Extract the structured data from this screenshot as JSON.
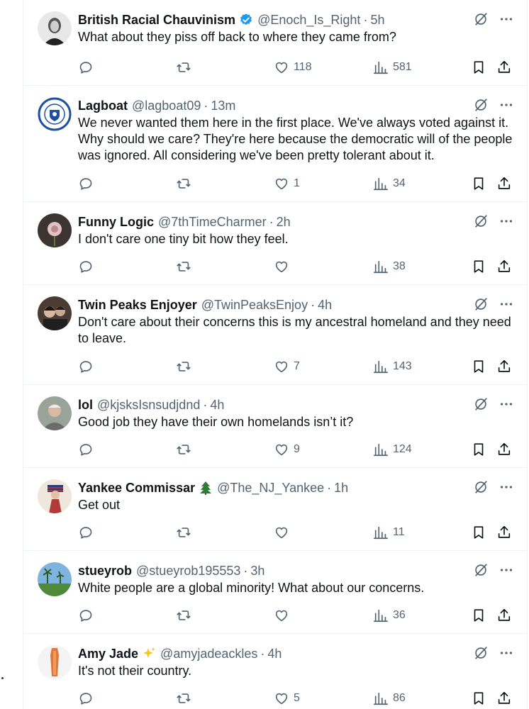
{
  "colors": {
    "text": "#0f1419",
    "secondary": "#536471",
    "verified": "#1d9bf0",
    "border": "#eff3f4"
  },
  "tweets": [
    {
      "name": "British Racial Chauvinism",
      "verified": true,
      "handle": "@Enoch_Is_Right",
      "time": "5h",
      "text": "What about they piss off back to where they came from?",
      "likes": "118",
      "views": "581"
    },
    {
      "name": "Lagboat",
      "handle": "@lagboat09",
      "time": "13m",
      "text": "We never wanted them here in the first place. We've always voted against it. Why should we care? They're here because the democratic will of the people was ignored. All considering we've been pretty tolerant about it.",
      "likes": "1",
      "views": "34"
    },
    {
      "name": "Funny Logic",
      "handle": "@7thTimeCharmer",
      "time": "2h",
      "text": "I don't care one tiny bit how they feel.",
      "likes": "",
      "views": "38"
    },
    {
      "name": "Twin Peaks Enjoyer",
      "handle": "@TwinPeaksEnjoy",
      "time": "4h",
      "text": "Don't care about their concerns this is my ancestral homeland and they need to leave.",
      "likes": "7",
      "views": "143"
    },
    {
      "name": "lol",
      "handle": "@kjsksIsnsudjdnd",
      "time": "4h",
      "text": "Good job they have their own homelands isn’t it?",
      "likes": "9",
      "views": "124"
    },
    {
      "name": "Yankee Commissar",
      "name_emoji": "christmas-tree-icon",
      "handle": "@The_NJ_Yankee",
      "time": "1h",
      "text": "Get out",
      "likes": "",
      "views": "11"
    },
    {
      "name": "stueyrob",
      "handle": "@stueyrob195553",
      "time": "3h",
      "text": "White people are a global minority! What about our concerns.",
      "likes": "",
      "views": "36"
    },
    {
      "name": "Amy Jade",
      "name_emoji": "sparkles-icon",
      "handle": "@amyjadeackles",
      "time": "4h",
      "text": "It's not their country.",
      "likes": "5",
      "views": "86"
    }
  ],
  "separator": "·"
}
